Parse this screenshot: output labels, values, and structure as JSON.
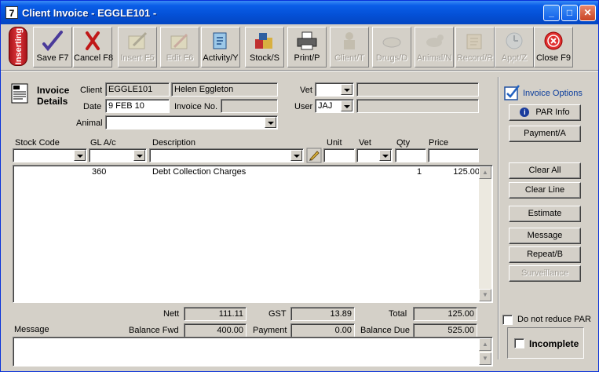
{
  "window": {
    "title": "Client Invoice - EGGLE101 -",
    "app_icon_glyph": "7",
    "controls": {
      "minimize": "_",
      "maximize": "□",
      "close": "✕"
    }
  },
  "toolbar": {
    "mode_badge": "Inserting",
    "buttons": [
      {
        "label": "Save F7",
        "icon": "pen-check-icon",
        "enabled": true
      },
      {
        "label": "Cancel F8",
        "icon": "red-x-icon",
        "enabled": true
      },
      {
        "label": "Insert F5",
        "icon": "insert-doc-icon",
        "enabled": false
      },
      {
        "label": "Edit F6",
        "icon": "edit-doc-icon",
        "enabled": false
      },
      {
        "label": "Activity/Y",
        "icon": "activity-icon",
        "enabled": true
      },
      {
        "label": "Stock/S",
        "icon": "stock-boxes-icon",
        "enabled": true
      },
      {
        "label": "Print/P",
        "icon": "printer-icon",
        "enabled": true
      },
      {
        "label": "Client/T",
        "icon": "client-icon",
        "enabled": false
      },
      {
        "label": "Drugs/D",
        "icon": "drugs-icon",
        "enabled": false
      },
      {
        "label": "Animal/N",
        "icon": "animal-icon",
        "enabled": false
      },
      {
        "label": "Record/R",
        "icon": "record-icon",
        "enabled": false
      },
      {
        "label": "Appt/Z",
        "icon": "appointment-icon",
        "enabled": false
      },
      {
        "label": "Close F9",
        "icon": "close-circle-icon",
        "enabled": true
      }
    ]
  },
  "header": {
    "section_title_1": "Invoice",
    "section_title_2": "Details",
    "client_label": "Client",
    "client_code": "EGGLE101",
    "client_name": "Helen Eggleton",
    "date_label": "Date",
    "date_value": "9 FEB 10",
    "invoice_no_label": "Invoice No.",
    "invoice_no_value": "",
    "animal_label": "Animal",
    "animal_value": "",
    "vet_label": "Vet",
    "vet_value": "",
    "vet_desc": "",
    "user_label": "User",
    "user_value": "JAJ",
    "user_desc": ""
  },
  "entry": {
    "stock_code_label": "Stock Code",
    "gl_label": "GL A/c",
    "description_label": "Description",
    "unit_label": "Unit",
    "vet_label": "Vet",
    "qty_label": "Qty",
    "price_label": "Price"
  },
  "lines": [
    {
      "gl": "360",
      "description": "Debt Collection Charges",
      "qty": "1",
      "price": "125.00"
    }
  ],
  "totals": {
    "nett_label": "Nett",
    "nett_value": "111.11",
    "gst_label": "GST",
    "gst_value": "13.89",
    "total_label": "Total",
    "total_value": "125.00",
    "balance_fwd_label": "Balance Fwd",
    "balance_fwd_value": "400.00",
    "payment_label": "Payment",
    "payment_value": "0.00",
    "balance_due_label": "Balance Due",
    "balance_due_value": "525.00"
  },
  "message": {
    "label": "Message",
    "value": ""
  },
  "side": {
    "invoice_options": "Invoice Options",
    "par_info": "PAR Info",
    "payment": "Payment/A",
    "clear_all": "Clear All",
    "clear_line": "Clear Line",
    "estimate": "Estimate",
    "message": "Message",
    "repeat": "Repeat/B",
    "surveillance": "Surveillance",
    "do_not_reduce_par": "Do not reduce PAR",
    "incomplete": "Incomplete"
  },
  "colors": {
    "title_blue": "#0450d6",
    "badge_red": "#d1282e",
    "disabled_text": "#a09c94"
  }
}
